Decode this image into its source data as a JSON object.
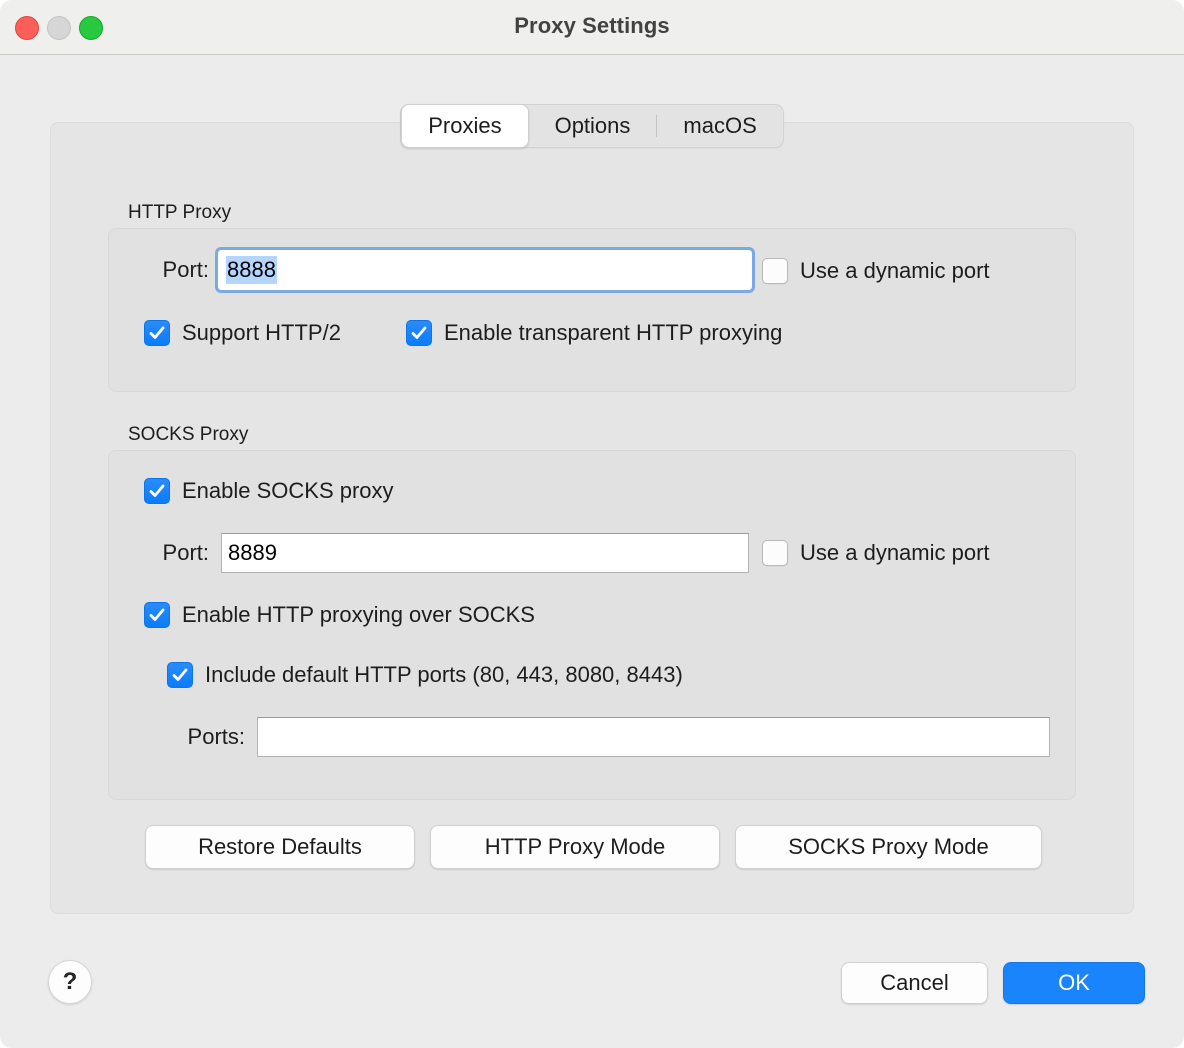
{
  "window": {
    "title": "Proxy Settings",
    "traffic_lights": [
      "close",
      "minimize",
      "zoom"
    ]
  },
  "tabs": [
    {
      "label": "Proxies",
      "selected": true
    },
    {
      "label": "Options",
      "selected": false
    },
    {
      "label": "macOS",
      "selected": false
    }
  ],
  "http_proxy": {
    "group_label": "HTTP Proxy",
    "port_label": "Port:",
    "port_value": "8888",
    "port_focused": true,
    "port_selected": true,
    "dynamic_port_label": "Use a dynamic port",
    "dynamic_port_checked": false,
    "support_http2_label": "Support HTTP/2",
    "support_http2_checked": true,
    "transparent_label": "Enable transparent HTTP proxying",
    "transparent_checked": true
  },
  "socks_proxy": {
    "group_label": "SOCKS Proxy",
    "enable_label": "Enable SOCKS proxy",
    "enable_checked": true,
    "port_label": "Port:",
    "port_value": "8889",
    "dynamic_port_label": "Use a dynamic port",
    "dynamic_port_checked": false,
    "http_over_socks_label": "Enable HTTP proxying over SOCKS",
    "http_over_socks_checked": true,
    "include_default_ports_label": "Include default HTTP ports (80, 443, 8080, 8443)",
    "include_default_ports_checked": true,
    "ports_label": "Ports:",
    "ports_value": "",
    "ports_placeholder": ""
  },
  "action_buttons": {
    "restore_defaults": "Restore Defaults",
    "http_proxy_mode": "HTTP Proxy Mode",
    "socks_proxy_mode": "SOCKS Proxy Mode"
  },
  "footer": {
    "help": "?",
    "cancel": "Cancel",
    "ok": "OK"
  },
  "colors": {
    "accent": "#1a84fc",
    "checkbox_on": "#0a7cfb",
    "selection": "#b4d5fe",
    "focus_ring": "#7aa9e6",
    "window_bg": "#ececec",
    "titlebar_bg": "#eff0ee",
    "panel_bg": "#e5e5e5",
    "group_bg": "#e1e1e1"
  }
}
